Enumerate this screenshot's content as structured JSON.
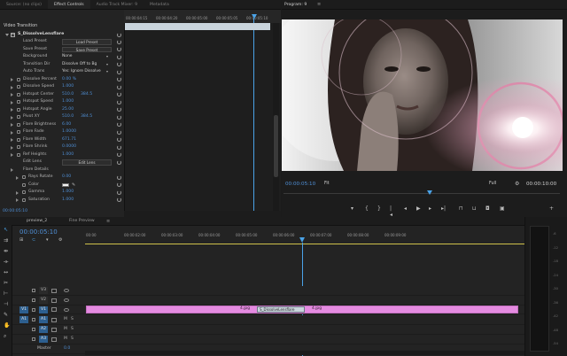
{
  "effect_controls": {
    "tabs": [
      "Source: (no clips)",
      "Effect Controls",
      "Audio Track Mixer: 9",
      "Metadata"
    ],
    "active_tab": 1,
    "section_title": "Video Transition",
    "effect_name": "S_DissolveLensflare",
    "rows": [
      {
        "label": "Load Preset",
        "button": "Load Preset"
      },
      {
        "label": "Save Preset",
        "button": "Save Preset"
      },
      {
        "label": "Background",
        "dropdown": "None"
      },
      {
        "label": "Transition Dir",
        "dropdown": "Dissolve Off to Bg"
      },
      {
        "label": "Auto Trans",
        "dropdown": "Yes: Ignore Dissolve"
      },
      {
        "label": "Dissolve Percent",
        "value": "0.00 %"
      },
      {
        "label": "Dissolve Speed",
        "value": "1.000"
      },
      {
        "label": "Hotspot Center",
        "value": "510.0",
        "value2": "384.5"
      },
      {
        "label": "Hotspot Speed",
        "value": "1.000"
      },
      {
        "label": "Hotspot Angle",
        "value": "25.00"
      },
      {
        "label": "Pivot XY",
        "value": "510.0",
        "value2": "384.5"
      },
      {
        "label": "Flare Brightness",
        "value": "6.00"
      },
      {
        "label": "Flare Fade",
        "value": "1.0000"
      },
      {
        "label": "Flare Width",
        "value": "671.71"
      },
      {
        "label": "Flare Shrink",
        "value": "0.0000"
      },
      {
        "label": "Ref Heights",
        "value": "1.000"
      },
      {
        "label": "Edit Lens",
        "button": "Edit Lens"
      },
      {
        "label": "Flare Details"
      },
      {
        "label": "Rays Rotate",
        "value": "0.00"
      },
      {
        "label": "Color"
      },
      {
        "label": "Gamma",
        "value": "1.000"
      },
      {
        "label": "Saturation",
        "value": "1.000"
      }
    ],
    "timecode": "00:00:05:10",
    "ruler": [
      "00:00:04:15",
      "00:00:04:20",
      "00:00:05:00",
      "00:00:05:05",
      "00:00:05:10",
      "00:00:05:15"
    ]
  },
  "program": {
    "tab": "Program: 9",
    "timecode": "00:00:05:10",
    "fit": "Fit",
    "quality": "Full",
    "duration": "00:00:10:00"
  },
  "timeline": {
    "tabs": [
      "preview_2",
      "Fine Preview"
    ],
    "timecode": "00:00:05:10",
    "ruler": [
      "00:00",
      "00:00:02:00",
      "00:00:03:00",
      "00:00:04:00",
      "00:00:05:00",
      "00:00:06:00",
      "00:00:07:00",
      "00:00:08:00",
      "00:00:09:00"
    ],
    "tracks": [
      {
        "name": "V3",
        "type": "video"
      },
      {
        "name": "V2",
        "type": "video"
      },
      {
        "name": "V1",
        "type": "video",
        "source": "V1"
      },
      {
        "name": "A1",
        "type": "audio",
        "source": "A1"
      },
      {
        "name": "A2",
        "type": "audio"
      },
      {
        "name": "A3",
        "type": "audio"
      },
      {
        "name": "Master",
        "type": "master",
        "value": "0.0"
      }
    ],
    "clips": [
      {
        "label": "4.jpg"
      },
      {
        "label": "S_DissolveLensflare"
      },
      {
        "label": "4.jpg"
      }
    ]
  },
  "meters": {
    "ticks": [
      "-6",
      "-12",
      "-18",
      "-24",
      "-30",
      "-36",
      "-42",
      "-48",
      "-54"
    ]
  },
  "colors": {
    "accent_blue": "#4f8fd6",
    "clip_pink": "#e48be0",
    "playhead": "#4aa3e8"
  }
}
